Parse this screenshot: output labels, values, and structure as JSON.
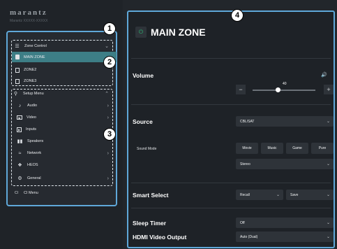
{
  "brand": {
    "logo": "marantz",
    "model": "Marantz XXXXX-XXXXX"
  },
  "callouts": [
    "1",
    "2",
    "3",
    "4"
  ],
  "zone_control": {
    "header": "Zone Control",
    "zones": [
      {
        "label": "MAIN ZONE",
        "icon": "speaker-icon",
        "selected": true
      },
      {
        "label": "ZONE2",
        "icon": "speaker-icon",
        "selected": false
      },
      {
        "label": "ZONE3",
        "icon": "speaker-icon",
        "selected": false
      }
    ]
  },
  "setup_menu": {
    "header": "Setup Menu",
    "items": [
      {
        "label": "Audio",
        "icon": "music-note-icon"
      },
      {
        "label": "Video",
        "icon": "video-icon"
      },
      {
        "label": "Inputs",
        "icon": "input-icon"
      },
      {
        "label": "Speakers",
        "icon": "speakers-icon"
      },
      {
        "label": "Network",
        "icon": "wifi-icon"
      },
      {
        "label": "HEOS",
        "icon": "heos-icon"
      },
      {
        "label": "General",
        "icon": "gear-icon"
      }
    ]
  },
  "cl_menu": {
    "label": "CI Menu"
  },
  "main": {
    "title": "MAIN ZONE",
    "volume": {
      "label": "Volume",
      "value": "40",
      "minus": "−",
      "plus": "+",
      "level": 0.4
    },
    "source": {
      "label": "Source",
      "value": "CBL/SAT"
    },
    "sound_mode": {
      "label": "Sound Mode",
      "buttons": [
        "Movie",
        "Music",
        "Game",
        "Pure"
      ],
      "value": "Stereo"
    },
    "smart_select": {
      "label": "Smart Select",
      "recall": "Recall",
      "save": "Save"
    },
    "sleep_timer": {
      "label": "Sleep Timer",
      "value": "Off"
    },
    "hdmi_output": {
      "label": "HDMI Video Output",
      "value": "Auto (Dual)"
    }
  },
  "colors": {
    "accent": "#5fa8d9",
    "selected": "#3d7e86",
    "power": "#2bb673"
  }
}
